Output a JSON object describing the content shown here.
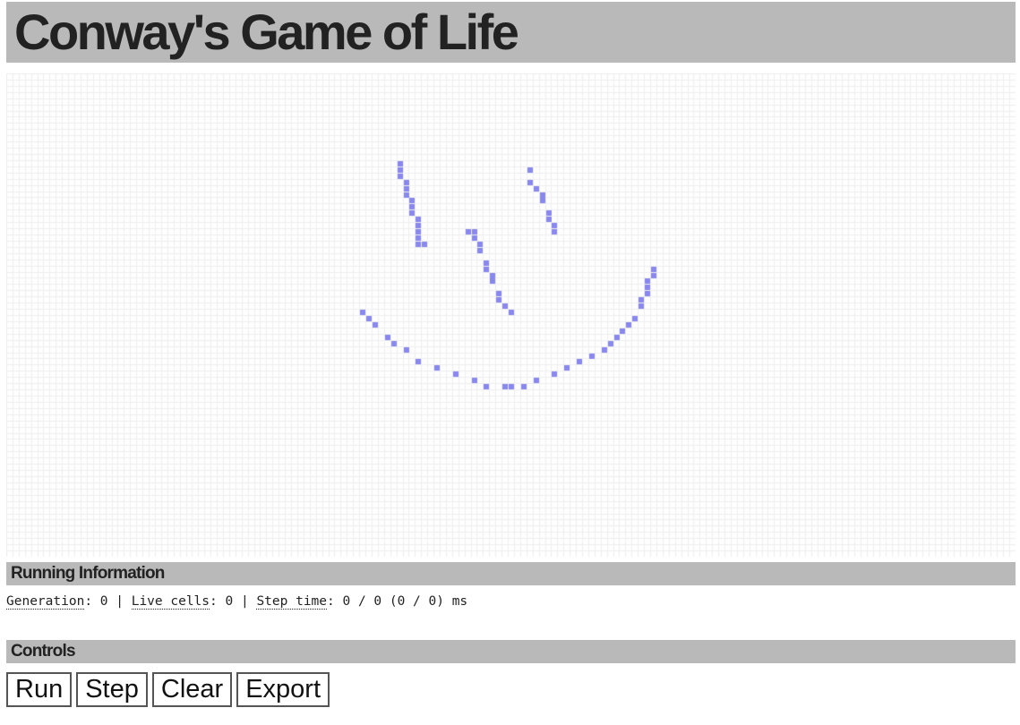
{
  "header": {
    "title": "Conway's Game of Life"
  },
  "grid": {
    "cols": 163,
    "rows": 78,
    "live_color": "#8888ee",
    "grid_line_color": "#eeeeee",
    "live_cells": [
      [
        63,
        14
      ],
      [
        63,
        15
      ],
      [
        63,
        16
      ],
      [
        64,
        17
      ],
      [
        64,
        18
      ],
      [
        64,
        19
      ],
      [
        65,
        20
      ],
      [
        65,
        21
      ],
      [
        65,
        22
      ],
      [
        66,
        23
      ],
      [
        66,
        24
      ],
      [
        66,
        25
      ],
      [
        66,
        26
      ],
      [
        66,
        27
      ],
      [
        67,
        27
      ],
      [
        84,
        15
      ],
      [
        84,
        17
      ],
      [
        85,
        18
      ],
      [
        86,
        19
      ],
      [
        86,
        20
      ],
      [
        87,
        22
      ],
      [
        87,
        23
      ],
      [
        88,
        24
      ],
      [
        88,
        25
      ],
      [
        74,
        25
      ],
      [
        75,
        25
      ],
      [
        75,
        26
      ],
      [
        76,
        27
      ],
      [
        76,
        28
      ],
      [
        77,
        30
      ],
      [
        77,
        31
      ],
      [
        78,
        32
      ],
      [
        78,
        33
      ],
      [
        79,
        35
      ],
      [
        79,
        36
      ],
      [
        80,
        37
      ],
      [
        81,
        38
      ],
      [
        57,
        38
      ],
      [
        58,
        39
      ],
      [
        59,
        40
      ],
      [
        61,
        42
      ],
      [
        62,
        43
      ],
      [
        64,
        44
      ],
      [
        66,
        46
      ],
      [
        69,
        47
      ],
      [
        72,
        48
      ],
      [
        75,
        49
      ],
      [
        77,
        50
      ],
      [
        80,
        50
      ],
      [
        81,
        50
      ],
      [
        83,
        50
      ],
      [
        85,
        49
      ],
      [
        88,
        48
      ],
      [
        90,
        47
      ],
      [
        92,
        46
      ],
      [
        94,
        45
      ],
      [
        96,
        44
      ],
      [
        97,
        43
      ],
      [
        98,
        42
      ],
      [
        99,
        41
      ],
      [
        100,
        40
      ],
      [
        101,
        39
      ],
      [
        102,
        37
      ],
      [
        102,
        36
      ],
      [
        103,
        35
      ],
      [
        103,
        34
      ],
      [
        103,
        33
      ],
      [
        104,
        32
      ],
      [
        104,
        31
      ]
    ]
  },
  "running_info": {
    "heading": "Running Information",
    "generation_label": "Generation",
    "generation_value": "0",
    "live_cells_label": "Live cells",
    "live_cells_value": "0",
    "step_time_label": "Step time",
    "step_time_value": "0 / 0 (0 / 0) ms"
  },
  "controls": {
    "heading": "Controls",
    "run_label": "Run",
    "step_label": "Step",
    "clear_label": "Clear",
    "export_label": "Export"
  }
}
